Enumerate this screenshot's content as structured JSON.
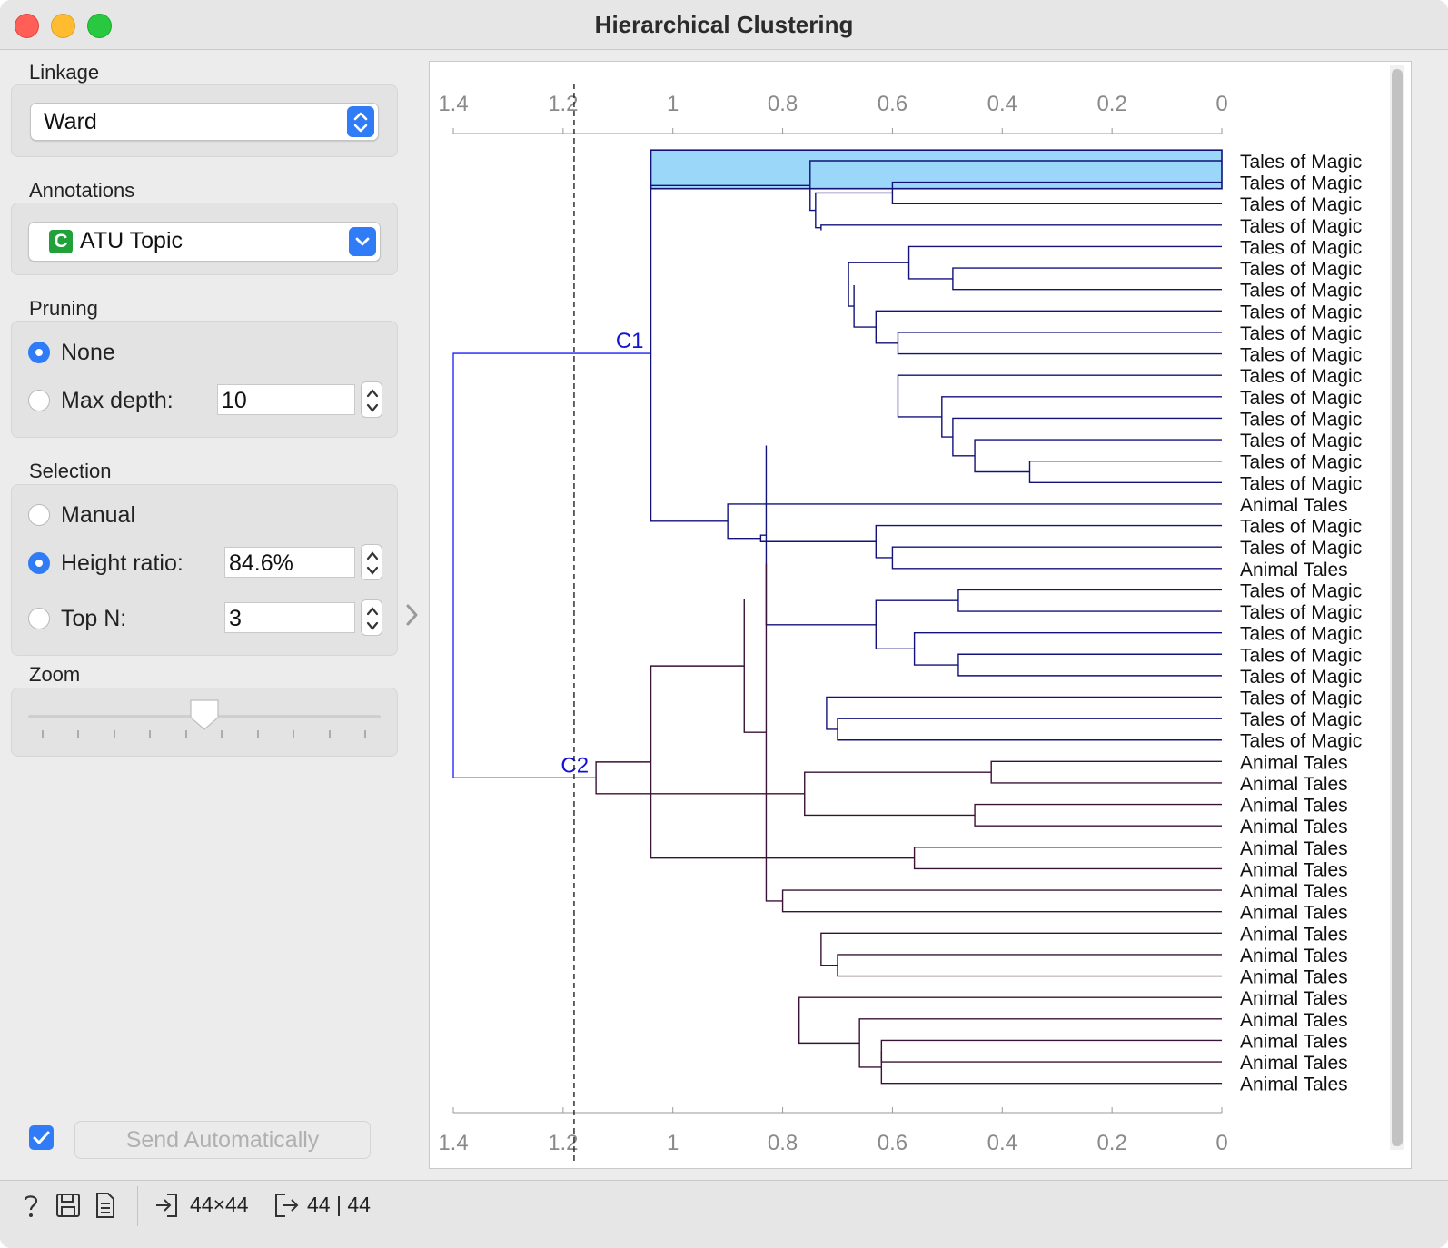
{
  "window": {
    "title": "Hierarchical Clustering"
  },
  "sidebar": {
    "linkage": {
      "label": "Linkage",
      "value": "Ward"
    },
    "annotations": {
      "label": "Annotations",
      "value": "ATU Topic",
      "type_badge": "C"
    },
    "pruning": {
      "label": "Pruning",
      "options": [
        "None",
        "Max depth:"
      ],
      "selected": "None",
      "max_depth": "10"
    },
    "selection": {
      "label": "Selection",
      "manual_label": "Manual",
      "height_ratio_label": "Height ratio:",
      "height_ratio_value": "84.6%",
      "top_n_label": "Top N:",
      "top_n_value": "3",
      "selected": "Height ratio:"
    },
    "zoom": {
      "label": "Zoom",
      "level": 0.5
    },
    "send": {
      "label": "Send Automatically",
      "checked": true
    }
  },
  "status": {
    "input_size": "44×44",
    "output_size": "44 | 44"
  },
  "chart_data": {
    "type": "dendrogram",
    "axis_ticks": [
      "1.4",
      "1.2",
      "1",
      "0.8",
      "0.6",
      "0.4",
      "0.2",
      "0"
    ],
    "xlim": [
      1.4,
      0
    ],
    "cutoff": 1.18,
    "clusters": [
      {
        "name": "C1",
        "color": "#9ad7f9",
        "edge": "#12127a"
      },
      {
        "name": "C2",
        "color": "#f3948a",
        "edge": "#3a1236"
      }
    ],
    "leaves": [
      "Tales of Magic",
      "Tales of Magic",
      "Tales of Magic",
      "Tales of Magic",
      "Tales of Magic",
      "Tales of Magic",
      "Tales of Magic",
      "Tales of Magic",
      "Tales of Magic",
      "Tales of Magic",
      "Tales of Magic",
      "Tales of Magic",
      "Tales of Magic",
      "Tales of Magic",
      "Tales of Magic",
      "Tales of Magic",
      "Animal Tales",
      "Tales of Magic",
      "Tales of Magic",
      "Animal Tales",
      "Tales of Magic",
      "Tales of Magic",
      "Tales of Magic",
      "Tales of Magic",
      "Tales of Magic",
      "Tales of Magic",
      "Tales of Magic",
      "Tales of Magic",
      "Animal Tales",
      "Animal Tales",
      "Animal Tales",
      "Animal Tales",
      "Animal Tales",
      "Animal Tales",
      "Animal Tales",
      "Animal Tales",
      "Animal Tales",
      "Animal Tales",
      "Animal Tales",
      "Animal Tales",
      "Animal Tales",
      "Animal Tales",
      "Animal Tales",
      "Animal Tales"
    ],
    "tree": [
      [
        [
          [
            0,
            [
              [
                1,
                2,
                0.6
              ],
              [
                3,
                [
                  [
                    [
                      4,
                      [
                        5,
                        6,
                        0.49
                      ],
                      0.57
                    ],
                    [
                      [
                        7,
                        [
                          8,
                          9,
                          0.59
                        ],
                        0.63
                      ],
                      [
                        [
                          10,
                          [
                            11,
                            [
                              12,
                              [
                                13,
                                [
                                  14,
                                  15,
                                  0.35
                                ],
                                0.45
                              ],
                              0.49
                            ],
                            0.51
                          ],
                          0.59
                        ],
                        0.63
                      ],
                      0.67
                    ],
                    0.68
                  ],
                  0.72
                ],
                0.73
              ],
              0.74
            ],
            0.75
          ],
          [
            16,
            [
              [
                17,
                [
                  18,
                  19,
                  0.6
                ],
                0.63
              ],
              [
                [
                  [
                    20,
                    21,
                    0.48
                  ],
                  [
                    22,
                    [
                      23,
                      24,
                      0.48
                    ],
                    0.56
                  ],
                  0.63
                ],
                [
                  [
                    25,
                    [
                      26,
                      27,
                      0.7
                    ],
                    0.72
                  ],
                  0.8
                ],
                0.83
              ],
              0.84
            ],
            0.9
          ],
          1.04
        ],
        [
          [
            [
              28,
              29,
              0.42
            ],
            [
              30,
              31,
              0.45
            ],
            0.76
          ],
          [
            [
              32,
              33,
              0.56
            ],
            [
              [
                [
                  34,
                  35,
                  0.8
                ],
                [
                  [
                    36,
                    [
                      37,
                      38,
                      0.7
                    ],
                    0.73
                  ],
                  0.8
                ],
                0.83
              ],
              [
                [
                  39,
                  [
                    40,
                    [
                      [
                        41,
                        42,
                        0.62
                      ],
                      43,
                      0.62
                    ],
                    0.66
                  ],
                  0.77
                ],
                0.84
              ],
              0.87
            ],
            1.04
          ],
          1.14
        ],
        1.4
      ]
    ]
  }
}
